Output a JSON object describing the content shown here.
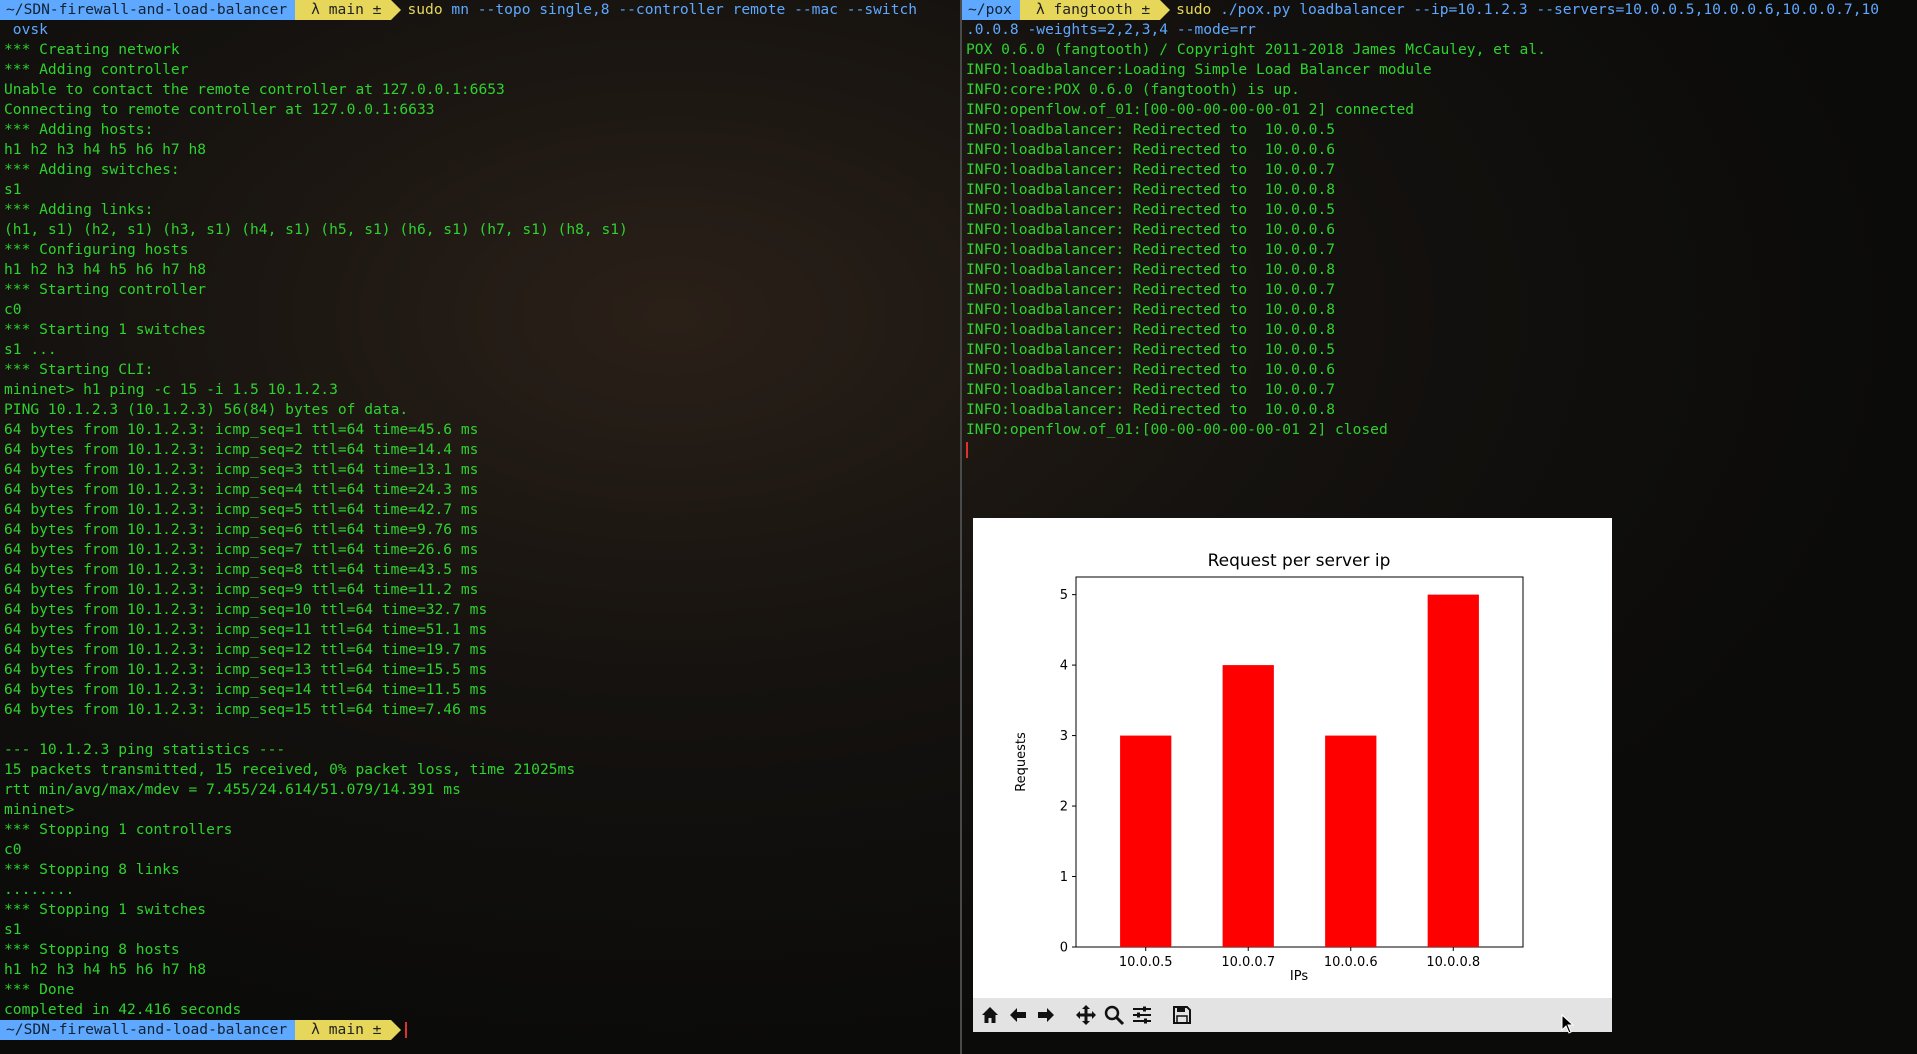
{
  "left_terminal": {
    "prompt_top": {
      "path": "~/SDN-firewall-and-load-balancer",
      "branch_icon": "git-branch-icon",
      "branch": "main ±",
      "command_sudo": "sudo",
      "command": " mn --topo single,8 --controller remote --mac --switch",
      "command_wrap": " ovsk"
    },
    "lines": [
      "*** Creating network",
      "*** Adding controller",
      "Unable to contact the remote controller at 127.0.0.1:6653",
      "Connecting to remote controller at 127.0.0.1:6633",
      "*** Adding hosts:",
      "h1 h2 h3 h4 h5 h6 h7 h8",
      "*** Adding switches:",
      "s1",
      "*** Adding links:",
      "(h1, s1) (h2, s1) (h3, s1) (h4, s1) (h5, s1) (h6, s1) (h7, s1) (h8, s1)",
      "*** Configuring hosts",
      "h1 h2 h3 h4 h5 h6 h7 h8",
      "*** Starting controller",
      "c0",
      "*** Starting 1 switches",
      "s1 ...",
      "*** Starting CLI:",
      "mininet> h1 ping -c 15 -i 1.5 10.1.2.3",
      "PING 10.1.2.3 (10.1.2.3) 56(84) bytes of data.",
      "64 bytes from 10.1.2.3: icmp_seq=1 ttl=64 time=45.6 ms",
      "64 bytes from 10.1.2.3: icmp_seq=2 ttl=64 time=14.4 ms",
      "64 bytes from 10.1.2.3: icmp_seq=3 ttl=64 time=13.1 ms",
      "64 bytes from 10.1.2.3: icmp_seq=4 ttl=64 time=24.3 ms",
      "64 bytes from 10.1.2.3: icmp_seq=5 ttl=64 time=42.7 ms",
      "64 bytes from 10.1.2.3: icmp_seq=6 ttl=64 time=9.76 ms",
      "64 bytes from 10.1.2.3: icmp_seq=7 ttl=64 time=26.6 ms",
      "64 bytes from 10.1.2.3: icmp_seq=8 ttl=64 time=43.5 ms",
      "64 bytes from 10.1.2.3: icmp_seq=9 ttl=64 time=11.2 ms",
      "64 bytes from 10.1.2.3: icmp_seq=10 ttl=64 time=32.7 ms",
      "64 bytes from 10.1.2.3: icmp_seq=11 ttl=64 time=51.1 ms",
      "64 bytes from 10.1.2.3: icmp_seq=12 ttl=64 time=19.7 ms",
      "64 bytes from 10.1.2.3: icmp_seq=13 ttl=64 time=15.5 ms",
      "64 bytes from 10.1.2.3: icmp_seq=14 ttl=64 time=11.5 ms",
      "64 bytes from 10.1.2.3: icmp_seq=15 ttl=64 time=7.46 ms",
      "",
      "--- 10.1.2.3 ping statistics ---",
      "15 packets transmitted, 15 received, 0% packet loss, time 21025ms",
      "rtt min/avg/max/mdev = 7.455/24.614/51.079/14.391 ms",
      "mininet>",
      "*** Stopping 1 controllers",
      "c0",
      "*** Stopping 8 links",
      "........",
      "*** Stopping 1 switches",
      "s1",
      "*** Stopping 8 hosts",
      "h1 h2 h3 h4 h5 h6 h7 h8",
      "*** Done",
      "completed in 42.416 seconds"
    ],
    "prompt_bottom": {
      "path": "~/SDN-firewall-and-load-balancer",
      "branch": "main ±"
    }
  },
  "right_terminal": {
    "prompt": {
      "path": "~/pox",
      "branch": "fangtooth ±",
      "command_sudo": "sudo",
      "command": " ./pox.py loadbalancer --ip=10.1.2.3 --servers=10.0.0.5,10.0.0.6,10.0.0.7,10",
      "command_wrap": ".0.0.8 -weights=2,2,3,4 --mode=rr"
    },
    "lines": [
      "POX 0.6.0 (fangtooth) / Copyright 2011-2018 James McCauley, et al.",
      "INFO:loadbalancer:Loading Simple Load Balancer module",
      "INFO:core:POX 0.6.0 (fangtooth) is up.",
      "INFO:openflow.of_01:[00-00-00-00-00-01 2] connected",
      "INFO:loadbalancer: Redirected to  10.0.0.5",
      "INFO:loadbalancer: Redirected to  10.0.0.6",
      "INFO:loadbalancer: Redirected to  10.0.0.7",
      "INFO:loadbalancer: Redirected to  10.0.0.8",
      "INFO:loadbalancer: Redirected to  10.0.0.5",
      "INFO:loadbalancer: Redirected to  10.0.0.6",
      "INFO:loadbalancer: Redirected to  10.0.0.7",
      "INFO:loadbalancer: Redirected to  10.0.0.8",
      "INFO:loadbalancer: Redirected to  10.0.0.7",
      "INFO:loadbalancer: Redirected to  10.0.0.8",
      "INFO:loadbalancer: Redirected to  10.0.0.8",
      "INFO:loadbalancer: Redirected to  10.0.0.5",
      "INFO:loadbalancer: Redirected to  10.0.0.6",
      "INFO:loadbalancer: Redirected to  10.0.0.7",
      "INFO:loadbalancer: Redirected to  10.0.0.8",
      "INFO:openflow.of_01:[00-00-00-00-00-01 2] closed"
    ]
  },
  "plot_window": {
    "toolbar": [
      {
        "icon": "home-icon",
        "name": "home-button"
      },
      {
        "icon": "arrow-left-icon",
        "name": "back-button"
      },
      {
        "icon": "arrow-right-icon",
        "name": "forward-button"
      },
      {
        "icon": "pan-icon",
        "name": "pan-button"
      },
      {
        "icon": "zoom-icon",
        "name": "zoom-button"
      },
      {
        "icon": "sliders-icon",
        "name": "configure-subplots-button"
      },
      {
        "icon": "save-icon",
        "name": "save-button"
      }
    ]
  },
  "chart_data": {
    "type": "bar",
    "title": "Request per server ip",
    "xlabel": "IPs",
    "ylabel": "Requests",
    "categories": [
      "10.0.0.5",
      "10.0.0.7",
      "10.0.0.6",
      "10.0.0.8"
    ],
    "values": [
      3,
      4,
      3,
      5
    ],
    "ylim": [
      0,
      5.25
    ],
    "yticks": [
      0,
      1,
      2,
      3,
      4,
      5
    ],
    "bar_color": "#ff0000",
    "grid": false,
    "legend": "none"
  },
  "colors": {
    "terminal_text": "#2fd12f",
    "command_text": "#5fa8ff",
    "prompt_path_bg": "#5fa8ff",
    "prompt_git_bg": "#e6d75a"
  }
}
